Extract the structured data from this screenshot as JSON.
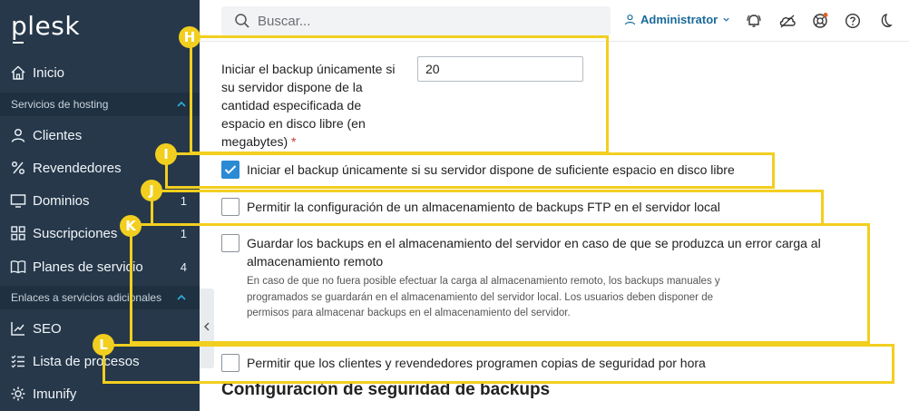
{
  "sidebar": {
    "logo": "plesk",
    "items": [
      {
        "label": "Inicio",
        "icon": "home-icon"
      },
      {
        "label": "Clientes",
        "icon": "user-icon"
      },
      {
        "label": "Revendedores",
        "icon": "percent-icon"
      },
      {
        "label": "Dominios",
        "icon": "monitor-icon",
        "count": "1"
      },
      {
        "label": "Suscripciones",
        "icon": "grid-icon",
        "count": "1"
      },
      {
        "label": "Planes de servicio",
        "icon": "book-icon",
        "count": "4"
      },
      {
        "label": "SEO",
        "icon": "chart-icon"
      },
      {
        "label": "Lista de procesos",
        "icon": "list-icon"
      },
      {
        "label": "Imunify",
        "icon": "gear-icon"
      }
    ],
    "sections": [
      {
        "label": "Servicios de hosting"
      },
      {
        "label": "Enlaces a servicios adicionales"
      }
    ]
  },
  "topbar": {
    "search_placeholder": "Buscar...",
    "user_label": "Administrator"
  },
  "form": {
    "min_space_label": "Iniciar el backup únicamente si su servidor dispone de la cantidad especificada de espacio en disco libre (en megabytes)",
    "required_mark": "*",
    "min_space_value": "20",
    "options": [
      {
        "label": "Iniciar el backup únicamente si su servidor dispone de suficiente espacio en disco libre",
        "checked": true
      },
      {
        "label": "Permitir la configuración de un almacenamiento de backups FTP en el servidor local",
        "checked": false
      },
      {
        "label": "Guardar los backups en el almacenamiento del servidor en caso de que se produzca un error carga al almacenamiento remoto",
        "checked": false
      },
      {
        "label": "Permitir que los clientes y revendedores programen copias de seguridad por hora",
        "checked": false
      }
    ],
    "hint": "En caso de que no fuera posible efectuar la carga al almacenamiento remoto, los backups manuales y programados se guardarán en el almacenamiento del servidor local. Los usuarios deben disponer de permisos para almacenar backups en el almacenamiento del servidor.",
    "section_title": "Configuración de seguridad de backups"
  },
  "callouts": [
    "H",
    "I",
    "J",
    "K",
    "L"
  ],
  "colors": {
    "sidebar": "#26384a",
    "accent": "#2a8ad4",
    "callout": "#f2cf1f"
  }
}
